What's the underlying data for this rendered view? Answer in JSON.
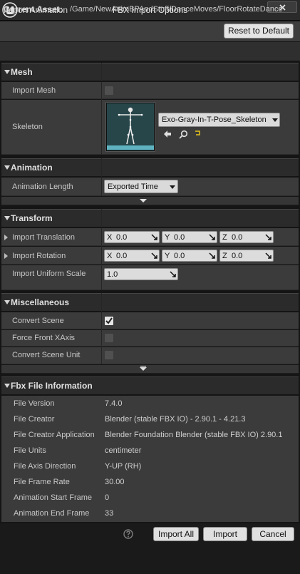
{
  "window": {
    "title": "FBX Import Options"
  },
  "top": {
    "import_animation_label": "Import Animation",
    "reset_button": "Reset to Default",
    "current_asset_label": "Current Asset:",
    "current_asset_value": "/Game/NewAnimBPAndStuff/DanceMoves/FloorRotateDance"
  },
  "mesh": {
    "header": "Mesh",
    "import_mesh_label": "Import Mesh",
    "import_mesh_checked": false,
    "skeleton_label": "Skeleton",
    "skeleton_value": "Exo-Gray-In-T-Pose_Skeleton"
  },
  "animation": {
    "header": "Animation",
    "length_label": "Animation Length",
    "length_value": "Exported Time"
  },
  "transform": {
    "header": "Transform",
    "translation_label": "Import Translation",
    "translation": {
      "x_axis": "X",
      "x": "0.0",
      "y_axis": "Y",
      "y": "0.0",
      "z_axis": "Z",
      "z": "0.0"
    },
    "rotation_label": "Import Rotation",
    "rotation": {
      "x_axis": "X",
      "x": "0.0",
      "y_axis": "Y",
      "y": "0.0",
      "z_axis": "Z",
      "z": "0.0"
    },
    "scale_label": "Import Uniform Scale",
    "scale_value": "1.0"
  },
  "misc": {
    "header": "Miscellaneous",
    "convert_scene_label": "Convert Scene",
    "convert_scene_checked": true,
    "force_front_label": "Force Front XAxis",
    "force_front_checked": false,
    "convert_unit_label": "Convert Scene Unit",
    "convert_unit_checked": false
  },
  "fbx_info": {
    "header": "Fbx File Information",
    "rows": [
      {
        "label": "File Version",
        "value": "7.4.0"
      },
      {
        "label": "File Creator",
        "value": "Blender (stable FBX IO) - 2.90.1 - 4.21.3"
      },
      {
        "label": "File Creator Application",
        "value": "Blender Foundation Blender (stable FBX IO) 2.90.1"
      },
      {
        "label": "File Units",
        "value": "centimeter"
      },
      {
        "label": "File Axis Direction",
        "value": "Y-UP (RH)"
      },
      {
        "label": "File Frame Rate",
        "value": "30.00"
      },
      {
        "label": "Animation Start Frame",
        "value": "0"
      },
      {
        "label": "Animation End Frame",
        "value": "33"
      }
    ]
  },
  "buttons": {
    "import_all": "Import All",
    "import": "Import",
    "cancel": "Cancel"
  },
  "colors": {
    "panel": "#3b3b3b",
    "header": "#2b2b2b",
    "accent_yellow": "#e8c21a"
  }
}
